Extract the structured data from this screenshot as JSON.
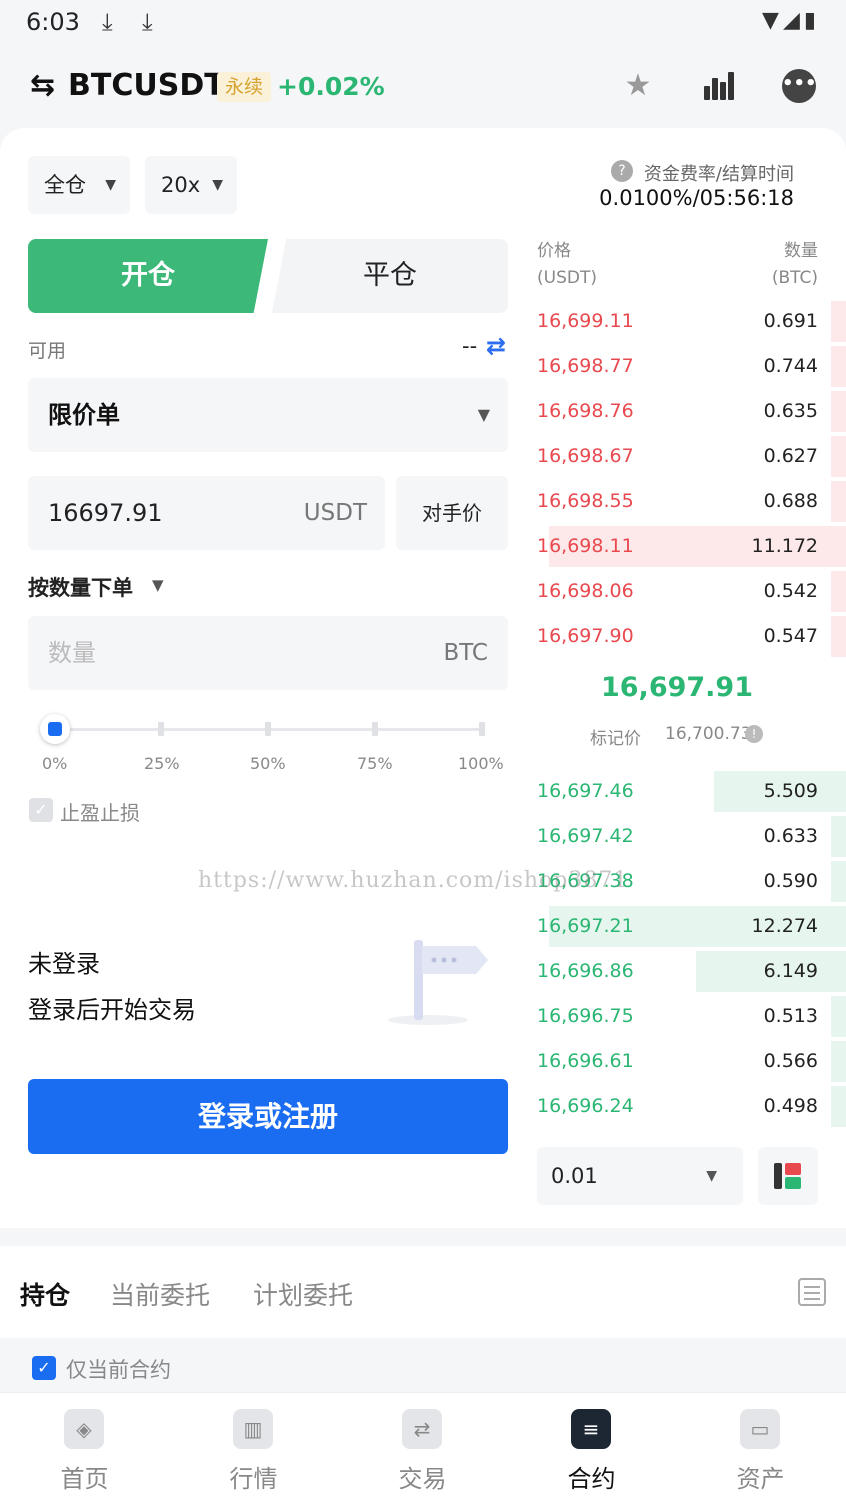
{
  "status_bar": {
    "time": "6:03",
    "download1": "⤓",
    "download2": "⤓",
    "right_icons": "▼◢▮"
  },
  "header": {
    "symbol": "BTCUSDT",
    "perp_badge": "永续",
    "change": "+0.02%",
    "swap_icon": "⇆",
    "star_icon": "★",
    "more_icon": "•••"
  },
  "margin": {
    "mode": "全仓",
    "leverage": "20x"
  },
  "funding": {
    "label": "资金费率/结算时间",
    "value": "0.0100%/05:56:18"
  },
  "trade_tabs": {
    "open": "开仓",
    "close": "平仓"
  },
  "available": {
    "label": "可用",
    "value": "--"
  },
  "order_type": "限价单",
  "price": {
    "value": "16697.91",
    "unit": "USDT",
    "counter_button": "对手价"
  },
  "qty_mode": "按数量下单",
  "quantity": {
    "placeholder": "数量",
    "unit": "BTC"
  },
  "slider": {
    "labels": [
      "0%",
      "25%",
      "50%",
      "75%",
      "100%"
    ],
    "value_percent": 0
  },
  "tpsl": {
    "label": "止盈止损",
    "checked": false
  },
  "login": {
    "title": "未登录",
    "subtitle": "登录后开始交易",
    "button": "登录或注册"
  },
  "orderbook": {
    "price_header": "价格",
    "price_unit": "(USDT)",
    "qty_header": "数量",
    "qty_unit": "(BTC)",
    "asks": [
      {
        "price": "16,699.11",
        "qty": "0.691",
        "depth": 0.05
      },
      {
        "price": "16,698.77",
        "qty": "0.744",
        "depth": 0.05
      },
      {
        "price": "16,698.76",
        "qty": "0.635",
        "depth": 0.05
      },
      {
        "price": "16,698.67",
        "qty": "0.627",
        "depth": 0.05
      },
      {
        "price": "16,698.55",
        "qty": "0.688",
        "depth": 0.05
      },
      {
        "price": "16,698.11",
        "qty": "11.172",
        "depth": 0.99
      },
      {
        "price": "16,698.06",
        "qty": "0.542",
        "depth": 0.05
      },
      {
        "price": "16,697.90",
        "qty": "0.547",
        "depth": 0.05
      }
    ],
    "last_price": "16,697.91",
    "mark_label": "标记价",
    "mark_price": "16,700.73",
    "bids": [
      {
        "price": "16,697.46",
        "qty": "5.509",
        "depth": 0.44
      },
      {
        "price": "16,697.42",
        "qty": "0.633",
        "depth": 0.05
      },
      {
        "price": "16,697.38",
        "qty": "0.590",
        "depth": 0.05
      },
      {
        "price": "16,697.21",
        "qty": "12.274",
        "depth": 0.99
      },
      {
        "price": "16,696.86",
        "qty": "6.149",
        "depth": 0.5
      },
      {
        "price": "16,696.75",
        "qty": "0.513",
        "depth": 0.05
      },
      {
        "price": "16,696.61",
        "qty": "0.566",
        "depth": 0.05
      },
      {
        "price": "16,696.24",
        "qty": "0.498",
        "depth": 0.05
      }
    ],
    "depth_step": "0.01"
  },
  "watermark": "https://www.huzhan.com/ishop3871",
  "positions": {
    "tabs": [
      "持仓",
      "当前委托",
      "计划委托"
    ],
    "current_only_label": "仅当前合约",
    "current_only_checked": true
  },
  "nav": [
    {
      "label": "首页",
      "icon": "home-icon",
      "glyph": "◈"
    },
    {
      "label": "行情",
      "icon": "market-icon",
      "glyph": "▥"
    },
    {
      "label": "交易",
      "icon": "trade-icon",
      "glyph": "⇄"
    },
    {
      "label": "合约",
      "icon": "contract-icon",
      "glyph": "≡",
      "active": true
    },
    {
      "label": "资产",
      "icon": "wallet-icon",
      "glyph": "▭"
    }
  ],
  "colors": {
    "green": "#2bb673",
    "red": "#e8494f",
    "blue": "#1a6cf0",
    "open_tab": "#3cb878"
  }
}
